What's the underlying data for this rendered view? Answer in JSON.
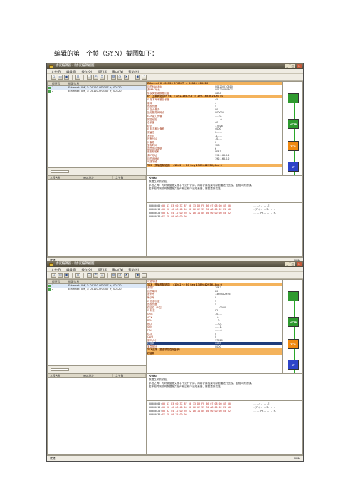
{
  "caption": "编辑的第一个帧（SYN）截图如下：",
  "windows": [
    {
      "title": "协议编辑器 - [协议编辑视图]",
      "menu": [
        "文件(F)",
        "编辑(E)",
        "操作(O)",
        "设置(S)",
        "窗口(W)",
        "帮助(H)"
      ],
      "packet_columns": [
        "帧序号",
        "摘要信息"
      ],
      "packets": [
        {
          "no": "1",
          "summary": "Ethernet: 0M[ 3: 00120-0F0307 +/ 00120"
        },
        {
          "no": "2",
          "summary": "Ethernet: 0M[ 3: 00120-0F0307 +/ 00120"
        }
      ],
      "field_columns": [
        "字段名称",
        "MAC地址",
        "字节数"
      ],
      "tree": [
        {
          "name": "Ethernet II : 00120-0F0307 -> 00120-010610",
          "value": "",
          "hdr": true
        },
        {
          "name": "目的MAC地址",
          "value": "00120-010610"
        },
        {
          "name": "源MAC地址",
          "value": "00120-0F0307"
        },
        {
          "name": "协议类型或数据长度",
          "value": "0800"
        },
        {
          "name": "IP（互联网协议IP v4） : 192.168.0.2 -> 192.168.0.2  Len 40",
          "value": "",
          "hdr": true
        },
        {
          "name": "⊟ 版本号和首部长度",
          "value": "45"
        },
        {
          "name": "    版本",
          "value": "4"
        },
        {
          "name": "    首部长度",
          "value": "5"
        },
        {
          "name": "⊟ 区分服务",
          "value": "00"
        },
        {
          "name": "    区分服务代码点",
          "value": "000000"
        },
        {
          "name": "    ECN能力传输",
          "value": "......0."
        },
        {
          "name": "    拥塞经历",
          "value": ".......0"
        },
        {
          "name": "总长度",
          "value": "40"
        },
        {
          "name": "标识",
          "value": "17926"
        },
        {
          "name": "⊟ 标志和片偏移",
          "value": "4000"
        },
        {
          "name": "    保留位",
          "value": "0......."
        },
        {
          "name": "    不分片",
          "value": ".1......"
        },
        {
          "name": "    还有分片",
          "value": "..0....."
        },
        {
          "name": "    片偏移",
          "value": "0"
        },
        {
          "name": "生存时间",
          "value": "128"
        },
        {
          "name": "高层协议类型",
          "value": "6"
        },
        {
          "name": "首部校验和",
          "value": "0E33"
        },
        {
          "name": "源IP地址",
          "value": "192.168.0.2"
        },
        {
          "name": "目的IP地址",
          "value": "192.168.0.2"
        },
        {
          "name": "可选字段",
          "value": ""
        },
        {
          "name": "TCP（传输控制协议） : 1042 -> 80  Seq 1389442956, Ack 0",
          "value": "",
          "hdr": true
        }
      ],
      "layers": [
        "HTTP",
        "TCP",
        "IP",
        "以太网"
      ],
      "info_label": "校验和：",
      "info_lines": [
        "数据之和的校验。",
        "字段之间：先对数据报文按字节进行计算，再将计算结果与原始值进行比较，若相同则无误。",
        "若不相同则说明数据报文在传输过程中出现差错，需要重新发送。"
      ],
      "hex": [
        {
          "off": "00000000:",
          "bytes": "00 13 D3 C0 3C 87 00 13 D3 FF 86 07 08 00 45 00",
          "ascii": "....<.....E."
        },
        {
          "off": "00000010:",
          "bytes": "00 28 46 06 40 00 80 06 0E 33 C0 A8 00 02 C0 A8",
          "ascii": ".(F.@....3....."
        },
        {
          "off": "00000020:",
          "bytes": "00 02 04 12 00 50 52 D0 14 8C 00 00 00 00 50 02",
          "ascii": ".....PR.......P."
        },
        {
          "off": "00000030:",
          "bytes": "FF FF 00 00 00 00",
          "ascii": "......"
        }
      ],
      "status": "就绪",
      "status_right": "NUM"
    },
    {
      "title": "协议编辑器 - [协议编辑视图]",
      "menu": [
        "文件(F)",
        "编辑(E)",
        "操作(O)",
        "设置(S)",
        "窗口(W)",
        "帮助(H)"
      ],
      "packet_columns": [
        "帧序号",
        "摘要信息"
      ],
      "packets": [
        {
          "no": "1",
          "summary": "Ethernet: 0M[ 3: 00120-0F0307 +/ 00120"
        },
        {
          "no": "2",
          "summary": "Ethernet: 0M[ 3: 00120-0F0307 +/ 00120"
        }
      ],
      "field_columns": [
        "字段名称",
        "MAC地址",
        "字节数"
      ],
      "tree": [
        {
          "name": "可选字段",
          "value": ""
        },
        {
          "name": "TCP（传输控制协议） : 1042 -> 80  Seq 1389442956, Ack 0",
          "value": "",
          "hdr": true
        },
        {
          "name": "源端口",
          "value": "1042"
        },
        {
          "name": "目的端口",
          "value": "80"
        },
        {
          "name": "序列号",
          "value": "1389442956"
        },
        {
          "name": "确认号",
          "value": "0"
        },
        {
          "name": "⊟ 首部长度",
          "value": "5"
        },
        {
          "name": "    首部长度",
          "value": "5"
        },
        {
          "name": "    保留位（6位）",
          "value": "......0000"
        },
        {
          "name": "⊟ 标志",
          "value": "02"
        },
        {
          "name": "    URG",
          "value": "..0....."
        },
        {
          "name": "    ACK",
          "value": "...0...."
        },
        {
          "name": "    PSH",
          "value": "....0..."
        },
        {
          "name": "    RST",
          "value": ".....0.."
        },
        {
          "name": "    SYN",
          "value": "......1."
        },
        {
          "name": "    FIN",
          "value": ".......0"
        },
        {
          "name": "    ECE",
          "value": "0"
        },
        {
          "name": "    CWR",
          "value": "0"
        },
        {
          "name": "窗口大小",
          "value": "17520"
        },
        {
          "name": "校验和",
          "value": "0035",
          "sel": true
        },
        {
          "name": "紧急指针",
          "value": "0000"
        },
        {
          "name": "TCP选项（若选项存在则显示）",
          "value": "",
          "hdr": true
        },
        {
          "name": "校验和",
          "value": "",
          "hdr": true
        }
      ],
      "layers": [
        "HTTP",
        "TCP",
        "IP",
        "以太网"
      ],
      "info_label": "校验和：",
      "info_lines": [
        "数据之和的校验。",
        "字段之间：先对数据报文按字节进行计算，再将计算结果与原始值进行比较，若相同则无误。",
        "若不相同则说明数据报文在传输过程中出现差错，需要重新发送。"
      ],
      "hex": [
        {
          "off": "00000000:",
          "bytes": "00 13 D3 C0 3C 87 00 13 D3 FF 86 07 08 00 45 00",
          "ascii": "....<.....E."
        },
        {
          "off": "00000010:",
          "bytes": "00 28 46 06 40 00 80 06 0E 33 C0 A8 00 02 C0 A8",
          "ascii": ".(F.@....3....."
        },
        {
          "off": "00000020:",
          "bytes": "00 02 04 12 00 50 52 D0 14 8C 00 00 00 00 50 02",
          "ascii": ".....PR.......P."
        },
        {
          "off": "00000030:",
          "bytes": "FF FF 00 35 00 00",
          "ascii": "......"
        }
      ],
      "status": "就绪",
      "status_right": "NUM"
    }
  ]
}
